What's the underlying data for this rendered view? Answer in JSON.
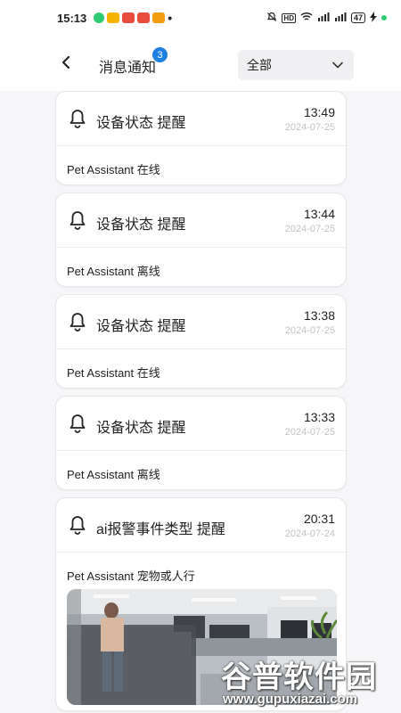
{
  "status_bar": {
    "time": "15:13",
    "battery": "47"
  },
  "header": {
    "title": "消息通知",
    "badge_count": "3",
    "filter": {
      "selected": "全部"
    }
  },
  "notifications": [
    {
      "title": "设备状态 提醒",
      "time": "13:49",
      "date": "2024-07-25",
      "message": "Pet Assistant 在线"
    },
    {
      "title": "设备状态 提醒",
      "time": "13:44",
      "date": "2024-07-25",
      "message": "Pet Assistant 离线"
    },
    {
      "title": "设备状态 提醒",
      "time": "13:38",
      "date": "2024-07-25",
      "message": "Pet Assistant 在线"
    },
    {
      "title": "设备状态 提醒",
      "time": "13:33",
      "date": "2024-07-25",
      "message": "Pet Assistant 离线"
    },
    {
      "title": "ai报警事件类型 提醒",
      "time": "20:31",
      "date": "2024-07-24",
      "message": "Pet Assistant 宠物或人行",
      "has_snapshot": true
    }
  ],
  "watermark": {
    "main": "谷普软件园",
    "url": "www.gupuxiazai.com"
  }
}
